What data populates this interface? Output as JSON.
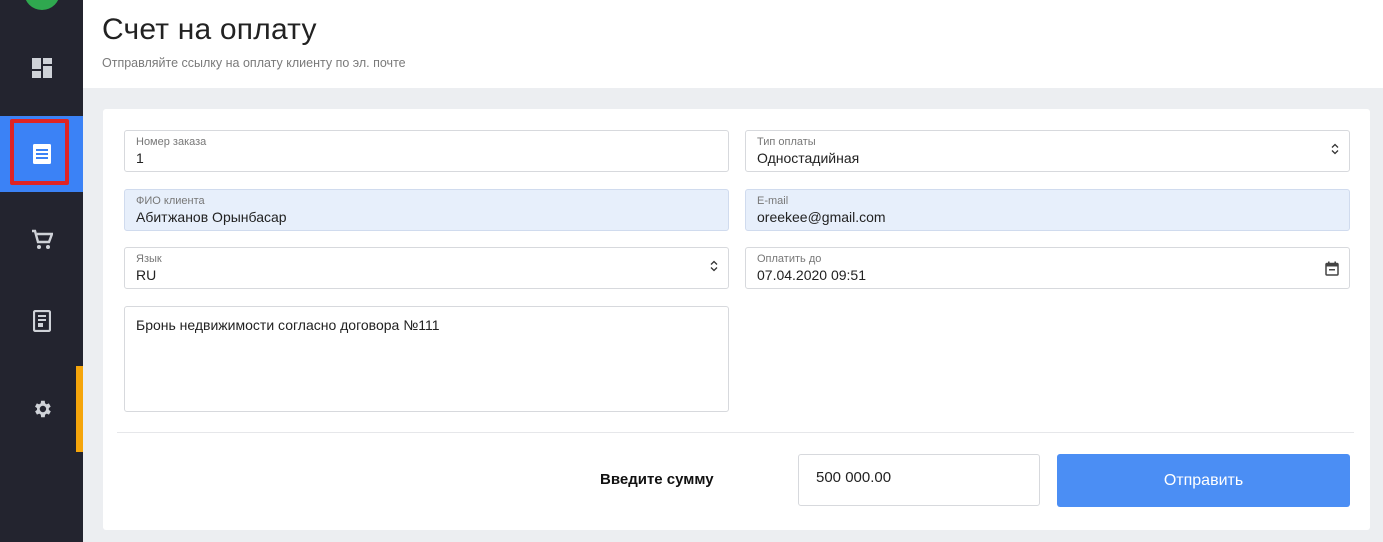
{
  "header": {
    "title": "Счет на оплату",
    "subtitle": "Отправляйте ссылку на оплату клиенту по эл. почте"
  },
  "sidebar": {
    "items": [
      {
        "icon": "dashboard-icon"
      },
      {
        "icon": "invoice-icon",
        "active": true
      },
      {
        "icon": "cart-icon"
      },
      {
        "icon": "receipt-icon"
      },
      {
        "icon": "gear-icon"
      }
    ],
    "active_color": "#3b82f6",
    "highlight_color": "#e02424",
    "accent_color": "#f5a50b"
  },
  "form": {
    "order_number": {
      "label": "Номер заказа",
      "value": "1"
    },
    "payment_type": {
      "label": "Тип оплаты",
      "value": "Одностадийная"
    },
    "client_name": {
      "label": "ФИО клиента",
      "value": "Абитжанов Орынбасар"
    },
    "email": {
      "label": "E-mail",
      "value": "oreekee@gmail.com"
    },
    "language": {
      "label": "Язык",
      "value": "RU"
    },
    "pay_until": {
      "label": "Оплатить до",
      "value": "07.04.2020 09:51"
    },
    "description": "Бронь недвижимости согласно договора №111",
    "amount_label": "Введите сумму",
    "amount_value": "500 000.00",
    "submit_label": "Отправить"
  }
}
